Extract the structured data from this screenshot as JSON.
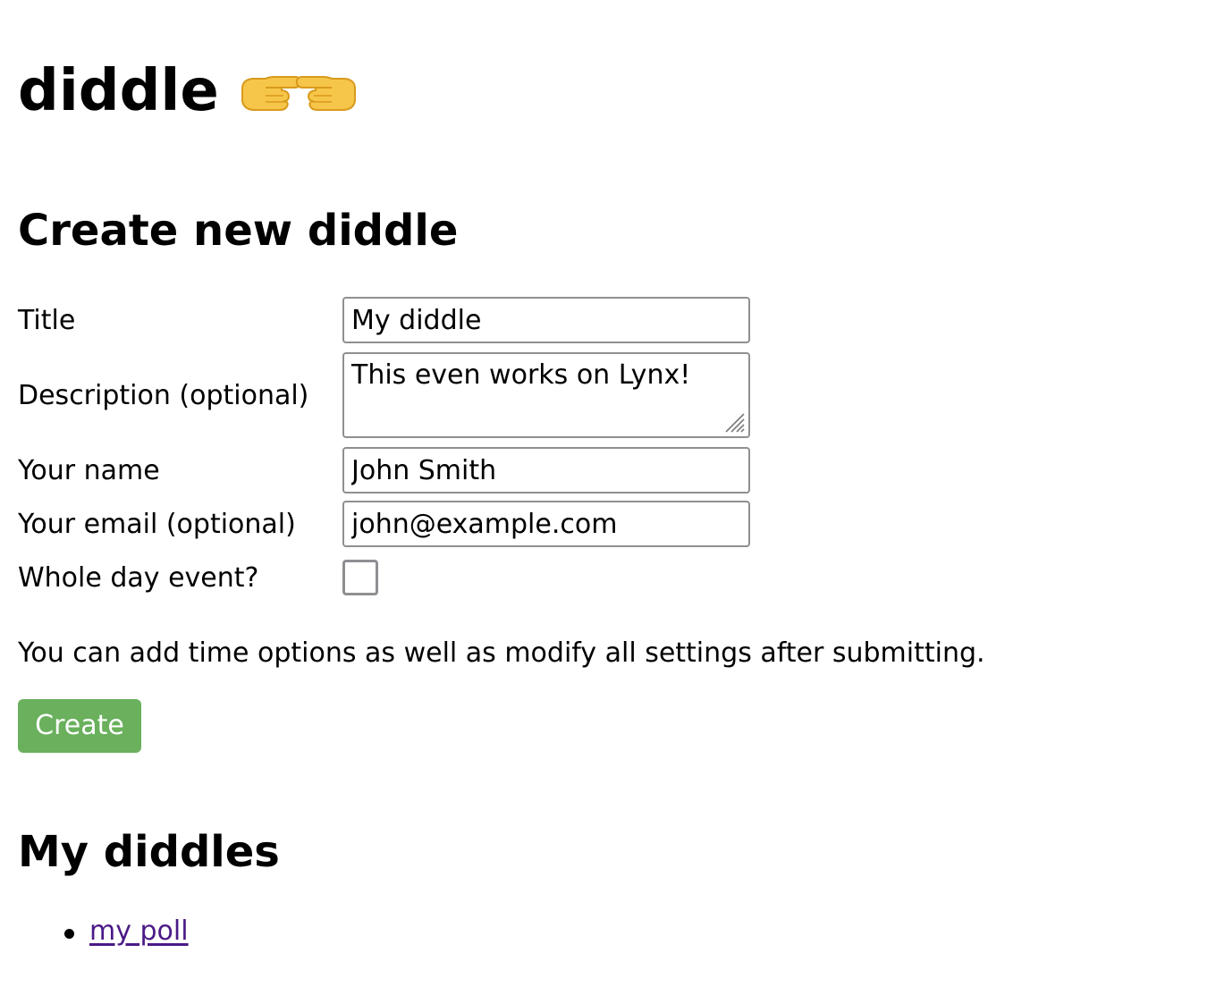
{
  "header": {
    "title": "diddle",
    "emoji_icon": "pointing-hands-icon"
  },
  "create": {
    "heading": "Create new diddle",
    "fields": {
      "title": {
        "label": "Title",
        "value": "My diddle"
      },
      "description": {
        "label": "Description (optional)",
        "value": "This even works on Lynx!"
      },
      "name": {
        "label": "Your name",
        "value": "John Smith"
      },
      "email": {
        "label": "Your email (optional)",
        "value": "john@example.com"
      },
      "whole_day": {
        "label": "Whole day event?",
        "checked": false
      }
    },
    "hint": "You can add time options as well as modify all settings after submitting.",
    "submit_label": "Create",
    "accent_color": "#6ab05d"
  },
  "my_diddles": {
    "heading": "My diddles",
    "items": [
      {
        "label": "my poll",
        "color": "#4b1a86"
      }
    ]
  }
}
